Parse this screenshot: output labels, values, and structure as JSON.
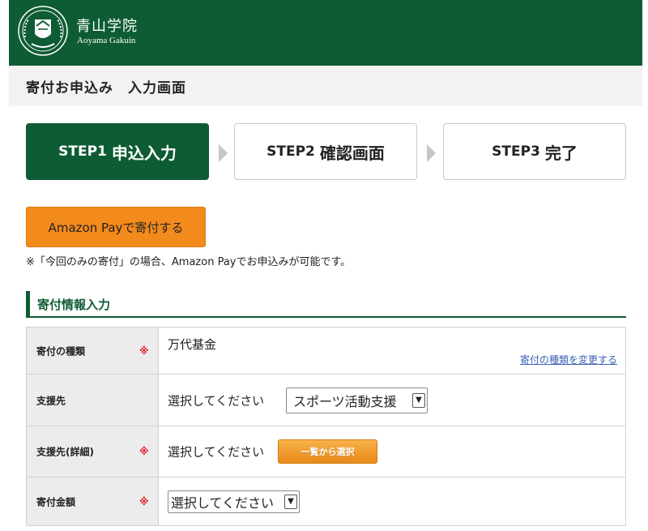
{
  "header": {
    "brand_jp": "青山学院",
    "brand_en": "Aoyama Gakuin",
    "bg_color": "#0e5c34",
    "logo_icon": "aoyama-gakuin-crest"
  },
  "page_title": "寄付お申込み　入力画面",
  "steps": [
    {
      "num": "STEP1",
      "label": "申込入力",
      "active": true
    },
    {
      "num": "STEP2",
      "label": "確認画面",
      "active": false
    },
    {
      "num": "STEP3",
      "label": "完了",
      "active": false
    }
  ],
  "amazon_pay": {
    "button_label": "Amazon Payで寄付する",
    "note": "※「今回のみの寄付」の場合、Amazon Payでお申込みが可能です。",
    "color": "#f38a1c"
  },
  "section_title": "寄付情報入力",
  "form": {
    "donation_type": {
      "label": "寄付の種類",
      "required": "※",
      "value": "万代基金",
      "change_link": "寄付の種類を変更する"
    },
    "support": {
      "label": "支援先",
      "prompt": "選択してください",
      "selected": "スポーツ活動支援"
    },
    "support_detail": {
      "label": "支援先(詳細)",
      "required": "※",
      "prompt": "選択してください",
      "button_label": "一覧から選択"
    },
    "amount": {
      "label": "寄付金額",
      "required": "※",
      "selected": "選択してください"
    }
  }
}
